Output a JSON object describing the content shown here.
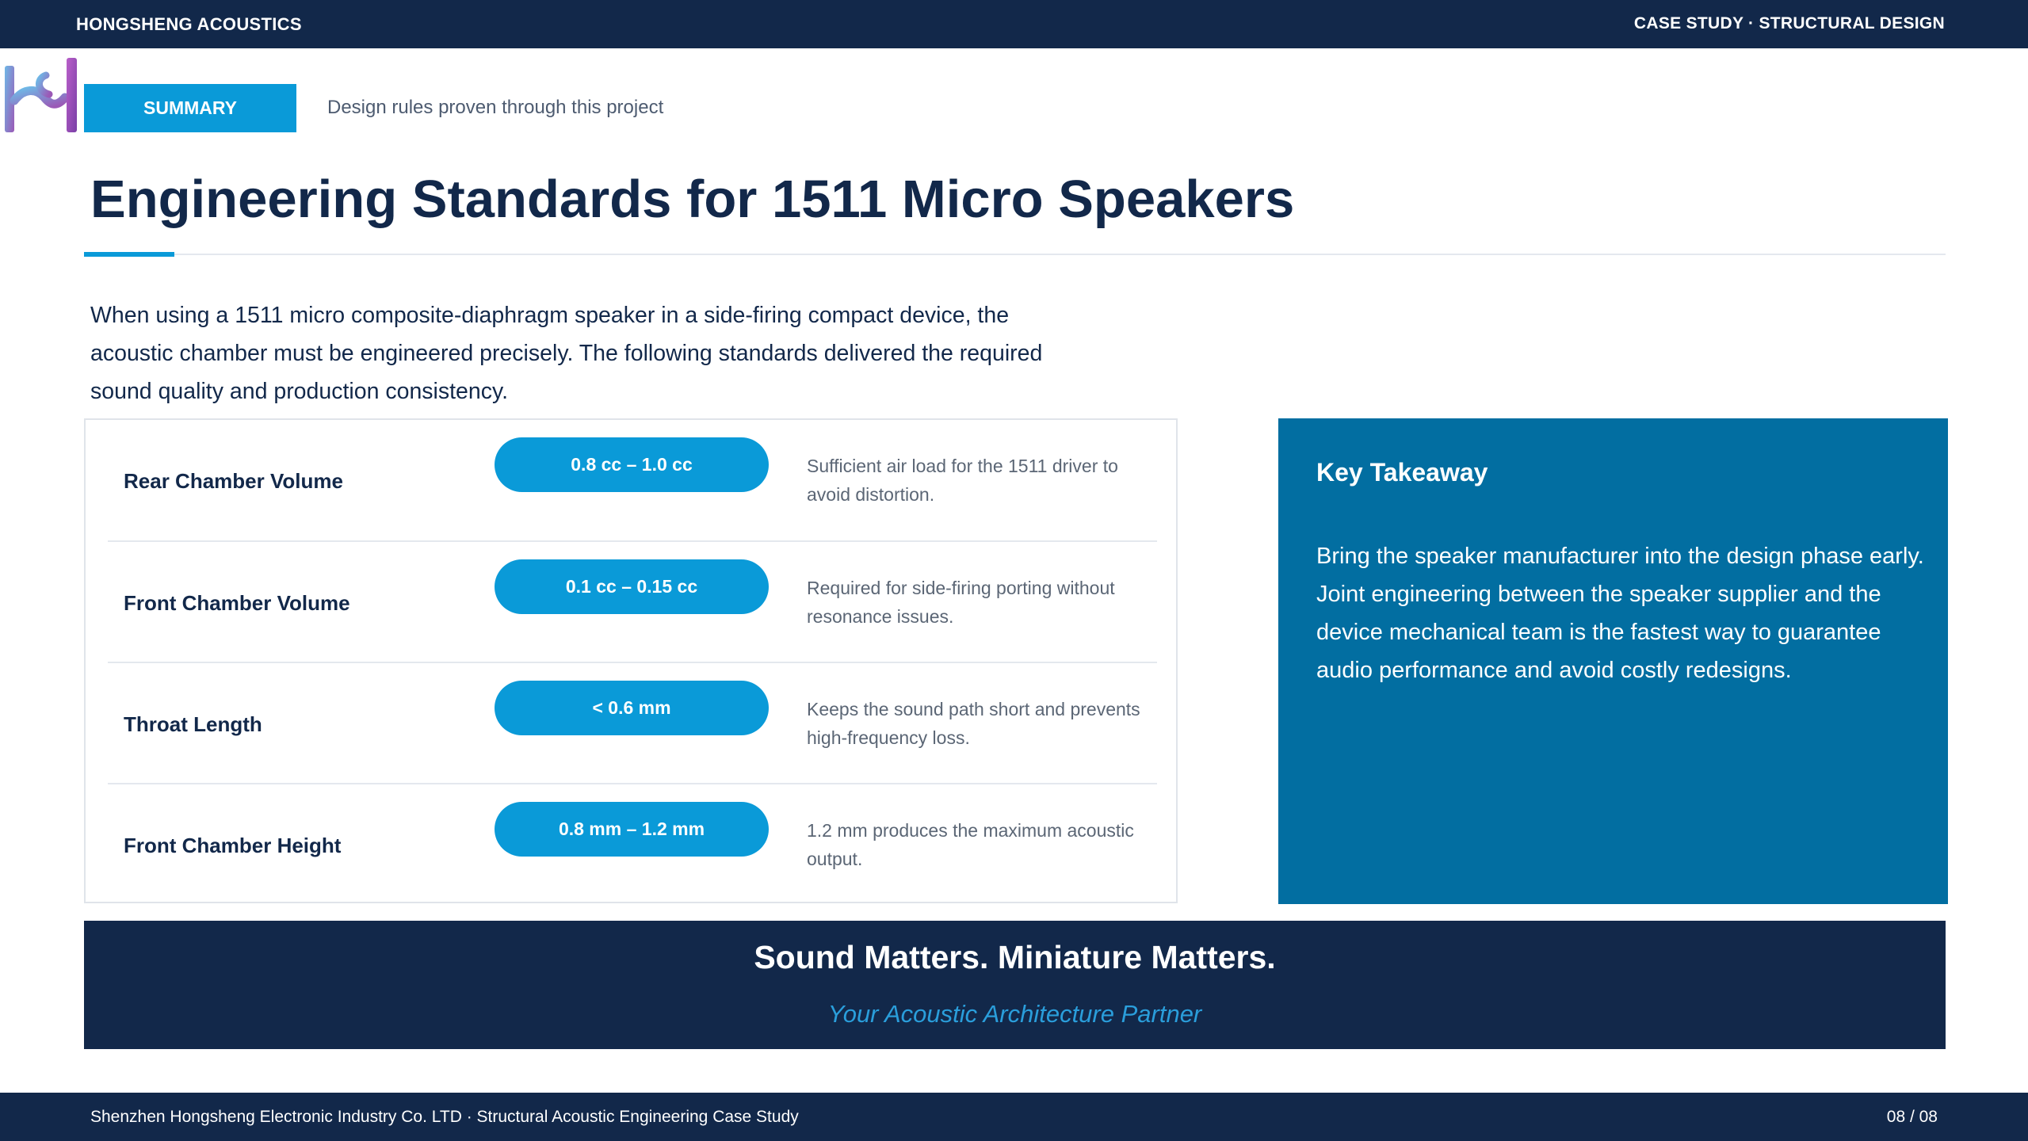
{
  "header": {
    "brand": "HONGSHENG ACOUSTICS",
    "section": "CASE STUDY · STRUCTURAL DESIGN"
  },
  "summary": {
    "badge": "SUMMARY",
    "subtitle": "Design rules proven through this project"
  },
  "title": "Engineering Standards for 1511 Micro Speakers",
  "intro": "When using a 1511 micro composite-diaphragm speaker in a side-firing compact device, the acoustic chamber must be engineered precisely. The following standards delivered the required sound quality and production consistency.",
  "specs": [
    {
      "label": "Rear Chamber Volume",
      "value": "0.8 cc – 1.0 cc",
      "note": "Sufficient air load for the 1511 driver to avoid distortion."
    },
    {
      "label": "Front Chamber Volume",
      "value": "0.1 cc – 0.15 cc",
      "note": "Required for side-firing porting without resonance issues."
    },
    {
      "label": "Throat Length",
      "value": "< 0.6 mm",
      "note": "Keeps the sound path short and prevents high-frequency loss."
    },
    {
      "label": "Front Chamber Height",
      "value": "0.8 mm – 1.2 mm",
      "note": "1.2 mm produces the maximum acoustic output."
    }
  ],
  "takeaway": {
    "heading": "Key Takeaway",
    "body": "Bring the speaker manufacturer into the design phase early. Joint engineering between the speaker supplier and the device mechanical team is the fastest way to guarantee audio performance and avoid costly redesigns."
  },
  "banner": {
    "headline": "Sound Matters. Miniature Matters.",
    "tagline": "Your Acoustic Architecture Partner"
  },
  "footer": {
    "text": "Shenzhen Hongsheng Electronic Industry Co. LTD · Structural Acoustic Engineering Case Study",
    "page": "08 / 08"
  },
  "colors": {
    "navy": "#12284a",
    "accent_blue": "#0a9ad8",
    "takeaway_blue": "#026ea1",
    "tagline_blue": "#2a9edb"
  }
}
